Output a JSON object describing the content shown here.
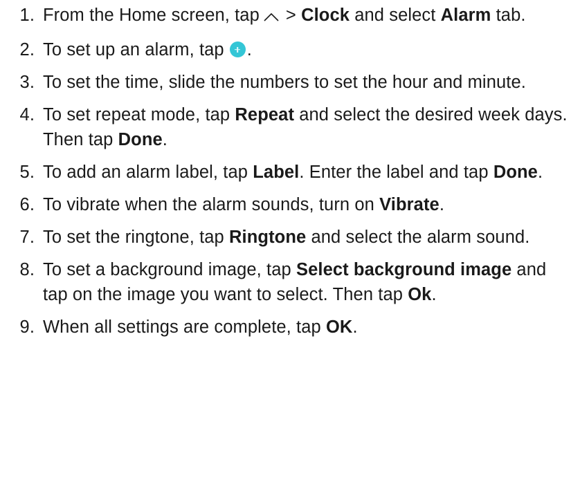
{
  "steps": [
    {
      "num": "1.",
      "parts": {
        "a": "From the Home screen, tap",
        "b": "> ",
        "c": "Clock",
        "d": " and select ",
        "e": "Alarm",
        "f": " tab."
      }
    },
    {
      "num": "2.",
      "parts": {
        "a": "To set up an alarm, tap",
        "b": "."
      }
    },
    {
      "num": "3.",
      "parts": {
        "a": "To set the time, slide the numbers to set the hour and minute."
      }
    },
    {
      "num": "4.",
      "parts": {
        "a": "To set repeat mode, tap ",
        "b": "Repeat",
        "c": " and select the desired week days. Then tap ",
        "d": "Done",
        "e": "."
      }
    },
    {
      "num": "5.",
      "parts": {
        "a": "To add an alarm label, tap ",
        "b": "Label",
        "c": ". Enter the label and tap ",
        "d": "Done",
        "e": "."
      }
    },
    {
      "num": "6.",
      "parts": {
        "a": "To vibrate when the alarm sounds, turn on ",
        "b": "Vibrate",
        "c": "."
      }
    },
    {
      "num": "7.",
      "parts": {
        "a": "To set the ringtone, tap ",
        "b": "Ringtone",
        "c": " and select the alarm sound."
      }
    },
    {
      "num": "8.",
      "parts": {
        "a": "To set a background image, tap ",
        "b": "Select background image",
        "c": " and tap on the image you want to select. Then tap ",
        "d": "Ok",
        "e": "."
      }
    },
    {
      "num": "9.",
      "parts": {
        "a": "When all settings are complete, tap ",
        "b": "OK",
        "c": "."
      }
    }
  ],
  "icons": {
    "step1": "chevron-up-icon",
    "step2": "add-circle-icon",
    "add_color": "#34c6d6"
  }
}
